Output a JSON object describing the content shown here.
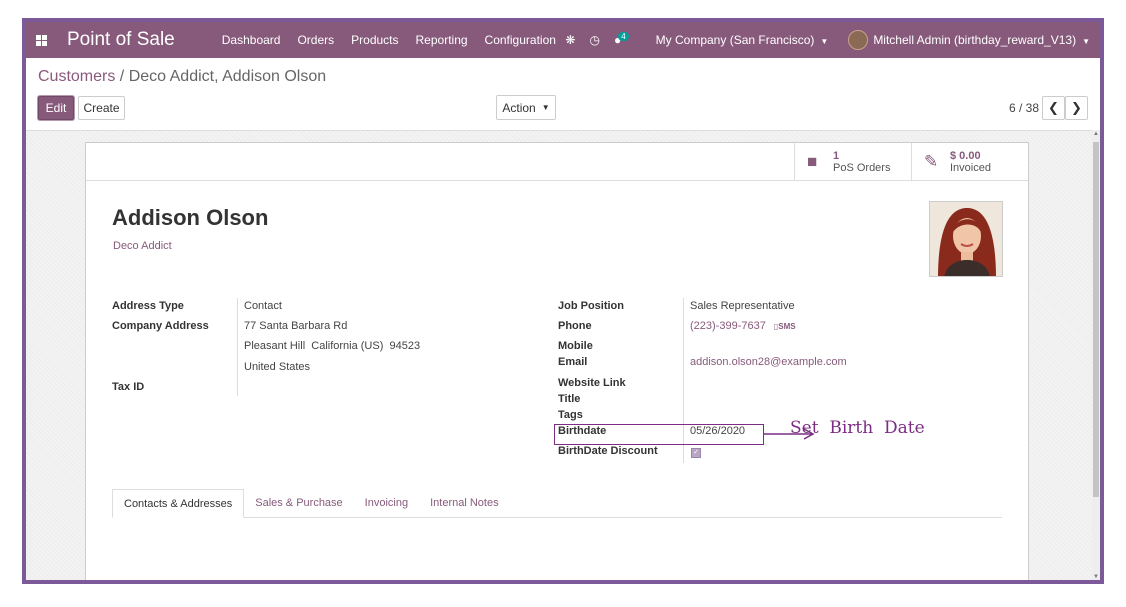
{
  "navbar": {
    "app_name": "Point of Sale",
    "menu": [
      "Dashboard",
      "Orders",
      "Products",
      "Reporting",
      "Configuration"
    ],
    "chat_count": "4",
    "company": "My Company (San Francisco)",
    "user": "Mitchell Admin (birthday_reward_V13)"
  },
  "breadcrumb": {
    "parent": "Customers",
    "separator": " / ",
    "current": "Deco Addict, Addison Olson"
  },
  "toolbar": {
    "edit": "Edit",
    "create": "Create",
    "action": "Action"
  },
  "pager": {
    "value": "6 / 38"
  },
  "stat_buttons": [
    {
      "value": "1",
      "label": "PoS Orders",
      "icon": "shopping-bag-icon"
    },
    {
      "value": "$ 0.00",
      "label": "Invoiced",
      "icon": "pencil-square-icon"
    }
  ],
  "partner": {
    "name": "Addison Olson",
    "company": "Deco Addict"
  },
  "left_fields": {
    "address_type_label": "Address Type",
    "address_type": "Contact",
    "company_address_label": "Company Address",
    "street": "77 Santa Barbara Rd",
    "city_line": "Pleasant Hill  California (US)  94523",
    "country": "United States",
    "tax_id_label": "Tax ID"
  },
  "right_fields": {
    "job_position_label": "Job Position",
    "job_position": "Sales Representative",
    "phone_label": "Phone",
    "phone": "(223)-399-7637",
    "sms": "SMS",
    "mobile_label": "Mobile",
    "email_label": "Email",
    "email": "addison.olson28@example.com",
    "website_label": "Website Link",
    "title_label": "Title",
    "tags_label": "Tags",
    "birthdate_label": "Birthdate",
    "birthdate": "05/26/2020",
    "birthdate_discount_label": "BirthDate Discount",
    "birthdate_discount": true
  },
  "tabs": [
    "Contacts & Addresses",
    "Sales & Purchase",
    "Invoicing",
    "Internal Notes"
  ],
  "annotation": {
    "text": "Set  Birth  Date",
    "color": "#7b2d83"
  },
  "colors": {
    "brand": "#875a7b",
    "frame": "#7c5a9a"
  }
}
